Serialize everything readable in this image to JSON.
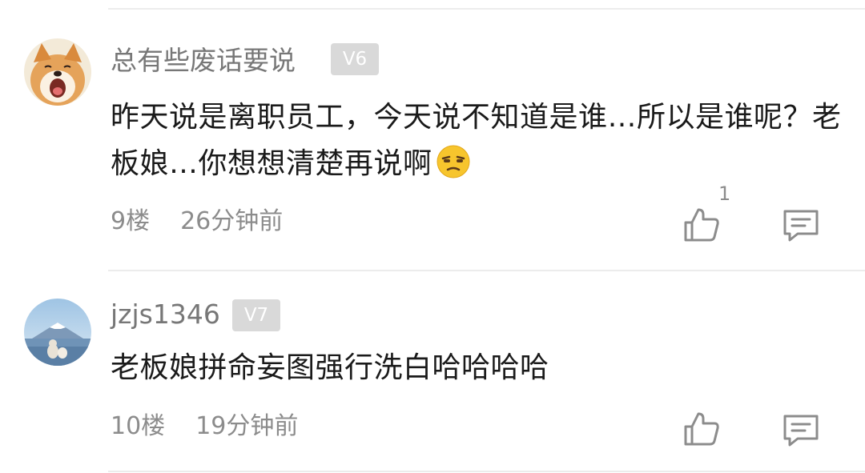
{
  "comments": [
    {
      "username": "总有些废话要说",
      "level": "V6",
      "text": "昨天说是离职员工，今天说不知道是谁…所以是谁呢？老板娘…你想想清楚再说啊",
      "floor": "9楼",
      "time": "26分钟前",
      "like_count": "1",
      "avatar": "shiba-dog-avatar",
      "emoji": "unamused-face"
    },
    {
      "username": "jzjs1346",
      "level": "V7",
      "text": "老板娘拼命妄图强行洗白哈哈哈哈",
      "floor": "10楼",
      "time": "19分钟前",
      "like_count": "",
      "avatar": "mountain-lake-avatar"
    }
  ],
  "colors": {
    "badge_bg": "#d9d9d9",
    "meta_text": "#8c8c8c",
    "username_text": "#777777"
  }
}
